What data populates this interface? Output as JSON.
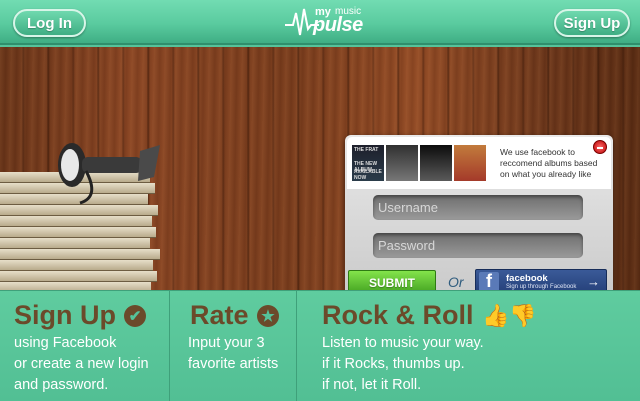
{
  "header": {
    "login_label": "Log In",
    "signup_label": "Sign Up",
    "logo": {
      "word_my": "my",
      "word_music": "music",
      "word_pulse": "pulse"
    }
  },
  "login_panel": {
    "albums": [
      {
        "label": "THE FRAY"
      },
      {
        "label": ""
      },
      {
        "label": ""
      },
      {
        "label": ""
      }
    ],
    "album_text": [
      "THE FRAT",
      "THE NEW ALBUM",
      "AVAILABLE NOW"
    ],
    "facebook_note": "We use facebook to reccomend albums based on what you already like",
    "username_placeholder": "Username",
    "password_placeholder": "Password",
    "submit_label": "SUBMIT",
    "or_label": "Or",
    "facebook_button": {
      "title": "facebook",
      "subtitle": "Sign up through Facebook",
      "logo": "f",
      "arrow": "→"
    }
  },
  "features": [
    {
      "title": "Sign Up",
      "icon": "check-circle-icon",
      "icon_glyph": "✔",
      "lines": [
        "using Facebook",
        "or create a new login",
        "and password."
      ]
    },
    {
      "title": "Rate",
      "icon": "star-circle-icon",
      "icon_glyph": "★",
      "lines": [
        "Input your 3",
        "favorite artists"
      ]
    },
    {
      "title": "Rock & Roll",
      "icon": "thumbs-icon",
      "icon_glyph": "👍👎",
      "lines": [
        "Listen to music your way.",
        "if it Rocks, thumbs up.",
        "if not, let it Roll."
      ]
    }
  ],
  "colors": {
    "header_green": "#5acb9f",
    "feature_brown": "#6b4a2a",
    "submit_green": "#5cbf2a",
    "facebook_blue": "#2f4d8a"
  }
}
